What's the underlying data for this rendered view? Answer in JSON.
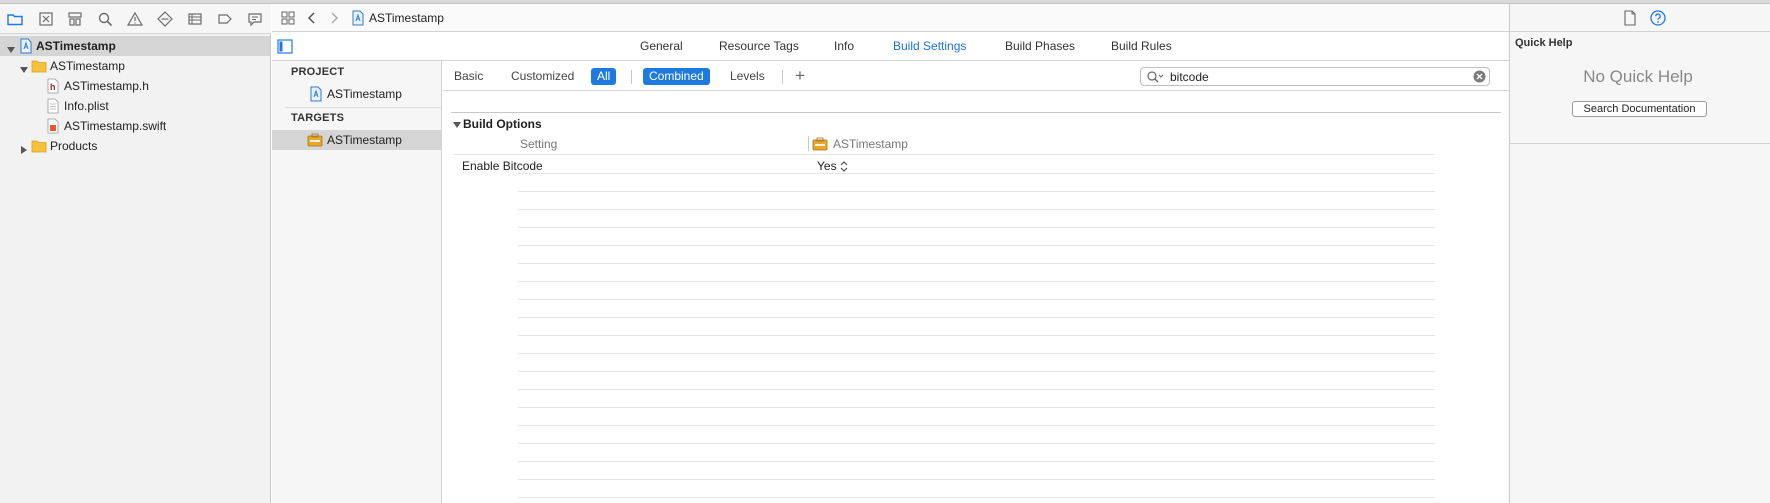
{
  "navigator": {
    "toolbar_icons": [
      "folder-icon",
      "source-control-icon",
      "symbol-icon",
      "find-icon",
      "issue-icon",
      "test-icon",
      "debug-icon",
      "breakpoint-icon",
      "report-icon"
    ],
    "project_name": "ASTimestamp",
    "group_name": "ASTimestamp",
    "files": [
      "ASTimestamp.h",
      "Info.plist",
      "ASTimestamp.swift"
    ],
    "products_label": "Products"
  },
  "jumpbar": {
    "breadcrumb": "ASTimestamp"
  },
  "tabs": [
    "General",
    "Resource Tags",
    "Info",
    "Build Settings",
    "Build Phases",
    "Build Rules"
  ],
  "active_tab": "Build Settings",
  "targets_panel": {
    "project_header": "PROJECT",
    "project_item": "ASTimestamp",
    "targets_header": "TARGETS",
    "target_item": "ASTimestamp"
  },
  "filter": {
    "basic": "Basic",
    "customized": "Customized",
    "all": "All",
    "combined": "Combined",
    "levels": "Levels",
    "add": "+",
    "search_value": "bitcode"
  },
  "build_settings": {
    "section_title": "Build Options",
    "column_setting": "Setting",
    "column_target": "ASTimestamp",
    "row": {
      "name": "Enable Bitcode",
      "value": "Yes"
    }
  },
  "inspector": {
    "title": "Quick Help",
    "empty_message": "No Quick Help",
    "search_button": "Search Documentation"
  },
  "colors": {
    "accent": "#1f7ae0",
    "selection": "#d5d5d5",
    "folder": "#f5c33b"
  }
}
